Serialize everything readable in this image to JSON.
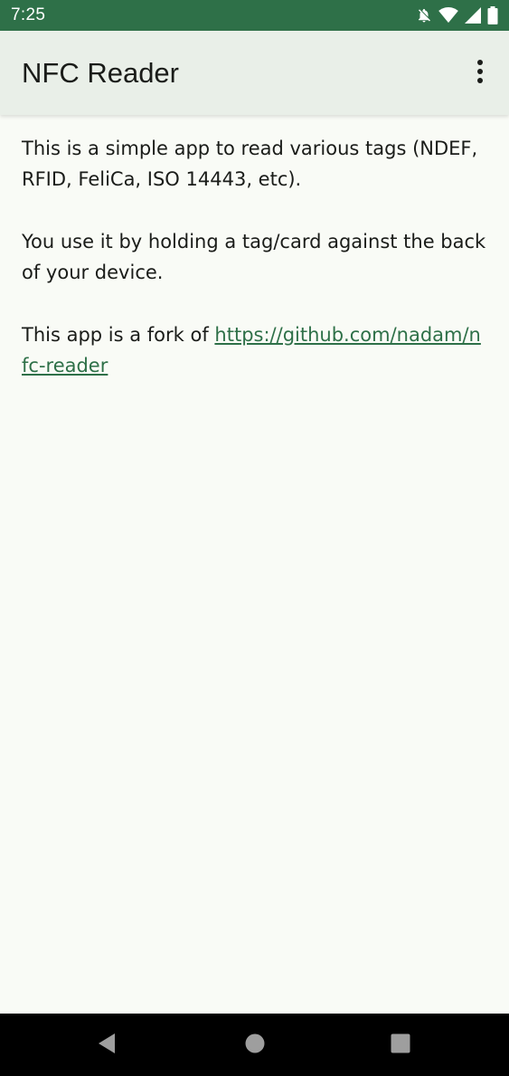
{
  "status_bar": {
    "time": "7:25",
    "icons": [
      "notifications-off-icon",
      "wifi-icon",
      "cell-signal-icon",
      "battery-icon"
    ]
  },
  "app_bar": {
    "title": "NFC Reader",
    "overflow_icon": "more-vert-icon"
  },
  "content": {
    "paragraph_1": "This is a simple app to read various tags (NDEF, RFID, FeliCa, ISO 14443, etc).",
    "paragraph_2": "You use it by holding a tag/card against the back of your device.",
    "paragraph_3_prefix": "This app is a fork of ",
    "link_text": "https://github.com/nadam/nfc-reader"
  },
  "nav_bar": {
    "icons": [
      "back-icon",
      "home-icon",
      "recents-icon"
    ]
  },
  "colors": {
    "status_bar": "#2e7048",
    "app_bar": "#e9efe8",
    "background": "#f9fbf6",
    "text": "#1a1c19",
    "link": "#2e7048",
    "nav_bar": "#000000"
  }
}
